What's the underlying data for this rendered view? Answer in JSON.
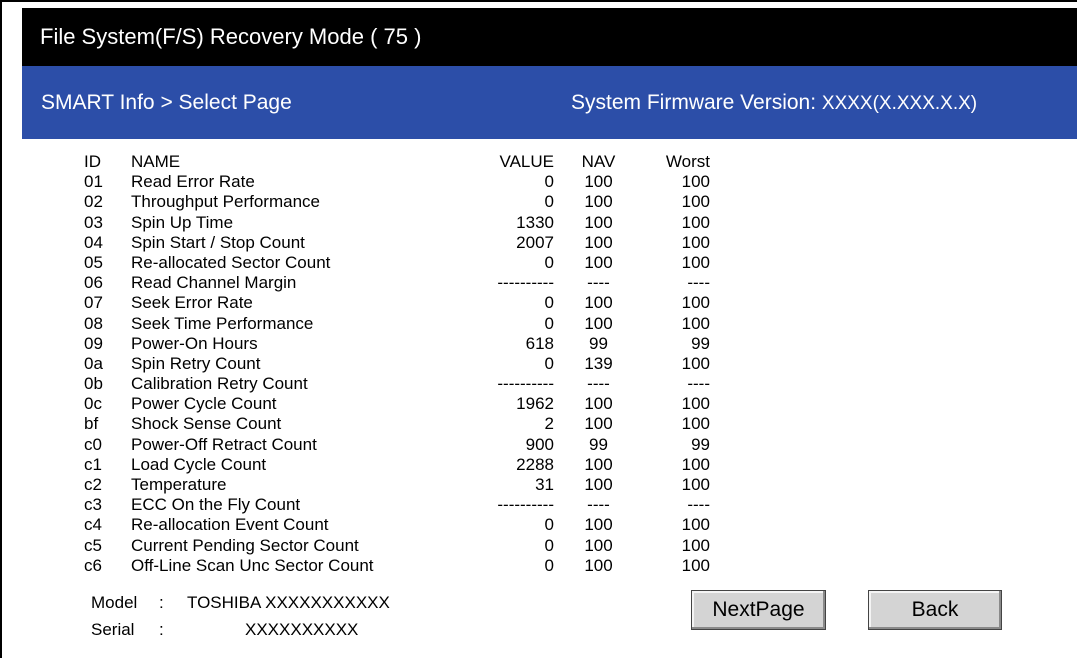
{
  "titlebar": {
    "title": "File System(F/S) Recovery Mode ( 75 )"
  },
  "header": {
    "breadcrumb": "SMART Info > Select Page",
    "firmware_label": "System Firmware Version:",
    "firmware_version": "XXXX(X.XXX.X.X)"
  },
  "table": {
    "columns": {
      "id": "ID",
      "name": "NAME",
      "value": "VALUE",
      "nav": "NAV",
      "worst": "Worst"
    },
    "rows": [
      {
        "id": "01",
        "name": "Read Error Rate",
        "value": "0",
        "nav": "100",
        "worst": "100"
      },
      {
        "id": "02",
        "name": "Throughput Performance",
        "value": "0",
        "nav": "100",
        "worst": "100"
      },
      {
        "id": "03",
        "name": "Spin Up Time",
        "value": "1330",
        "nav": "100",
        "worst": "100"
      },
      {
        "id": "04",
        "name": "Spin Start / Stop Count",
        "value": "2007",
        "nav": "100",
        "worst": "100"
      },
      {
        "id": "05",
        "name": "Re-allocated Sector Count",
        "value": "0",
        "nav": "100",
        "worst": "100"
      },
      {
        "id": "06",
        "name": "Read Channel Margin",
        "value": "----------",
        "nav": "----",
        "worst": "----"
      },
      {
        "id": "07",
        "name": "Seek Error Rate",
        "value": "0",
        "nav": "100",
        "worst": "100"
      },
      {
        "id": "08",
        "name": "Seek Time Performance",
        "value": "0",
        "nav": "100",
        "worst": "100"
      },
      {
        "id": "09",
        "name": "Power-On Hours",
        "value": "618",
        "nav": "99",
        "worst": "99"
      },
      {
        "id": "0a",
        "name": "Spin Retry Count",
        "value": "0",
        "nav": "139",
        "worst": "100"
      },
      {
        "id": "0b",
        "name": "Calibration Retry Count",
        "value": "----------",
        "nav": "----",
        "worst": "----"
      },
      {
        "id": "0c",
        "name": "Power Cycle Count",
        "value": "1962",
        "nav": "100",
        "worst": "100"
      },
      {
        "id": "bf",
        "name": "Shock Sense Count",
        "value": "2",
        "nav": "100",
        "worst": "100"
      },
      {
        "id": "c0",
        "name": "Power-Off Retract Count",
        "value": "900",
        "nav": "99",
        "worst": "99"
      },
      {
        "id": "c1",
        "name": "Load Cycle Count",
        "value": "2288",
        "nav": "100",
        "worst": "100"
      },
      {
        "id": "c2",
        "name": "Temperature",
        "value": "31",
        "nav": "100",
        "worst": "100"
      },
      {
        "id": "c3",
        "name": "ECC On the Fly Count",
        "value": "----------",
        "nav": "----",
        "worst": "----"
      },
      {
        "id": "c4",
        "name": "Re-allocation Event Count",
        "value": "0",
        "nav": "100",
        "worst": "100"
      },
      {
        "id": "c5",
        "name": "Current Pending Sector Count",
        "value": "0",
        "nav": "100",
        "worst": "100"
      },
      {
        "id": "c6",
        "name": "Off-Line Scan Unc Sector Count",
        "value": "0",
        "nav": "100",
        "worst": "100"
      }
    ]
  },
  "device": {
    "model_label": "Model",
    "separator": ":",
    "model_value": "TOSHIBA XXXXXXXXXXX",
    "serial_label": "Serial",
    "serial_value": "XXXXXXXXXX"
  },
  "buttons": {
    "next_page": "NextPage",
    "back": "Back"
  },
  "colors": {
    "titlebar_bg": "#000000",
    "header_bg": "#2c4ea8",
    "header_text": "#ffffff",
    "button_bg": "#d4d4d4"
  }
}
